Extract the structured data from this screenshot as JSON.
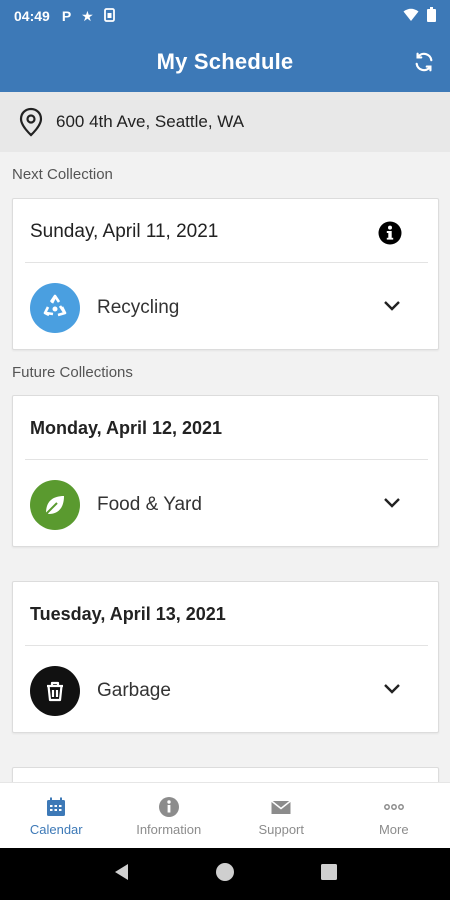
{
  "status_bar": {
    "time": "04:49",
    "icons": [
      "parking-icon",
      "star-icon",
      "sim-icon"
    ],
    "right_icons": [
      "wifi-icon",
      "battery-icon"
    ]
  },
  "header": {
    "title": "My Schedule",
    "refresh_icon": "refresh-icon"
  },
  "location": {
    "icon": "location-pin-icon",
    "address": "600 4th Ave, Seattle, WA"
  },
  "next_collection": {
    "label": "Next Collection",
    "card": {
      "date": "Sunday, April 11, 2021",
      "type": "Recycling",
      "icon": "recycle-icon",
      "color": "#4a9fe0"
    }
  },
  "future_collections": {
    "label": "Future Collections",
    "cards": [
      {
        "date": "Monday, April 12, 2021",
        "type": "Food & Yard",
        "icon": "leaf-icon",
        "color": "#5a9a2f"
      },
      {
        "date": "Tuesday, April 13, 2021",
        "type": "Garbage",
        "icon": "trash-can-icon",
        "color": "#111111"
      }
    ]
  },
  "bottom_nav": {
    "items": [
      {
        "label": "Calendar",
        "icon": "calendar-icon",
        "active": true
      },
      {
        "label": "Information",
        "icon": "info-icon",
        "active": false
      },
      {
        "label": "Support",
        "icon": "envelope-icon",
        "active": false
      },
      {
        "label": "More",
        "icon": "more-dots-icon",
        "active": false
      }
    ]
  },
  "colors": {
    "primary": "#3d79b7",
    "recycling": "#4a9fe0",
    "food_yard": "#5a9a2f",
    "garbage": "#111111"
  }
}
